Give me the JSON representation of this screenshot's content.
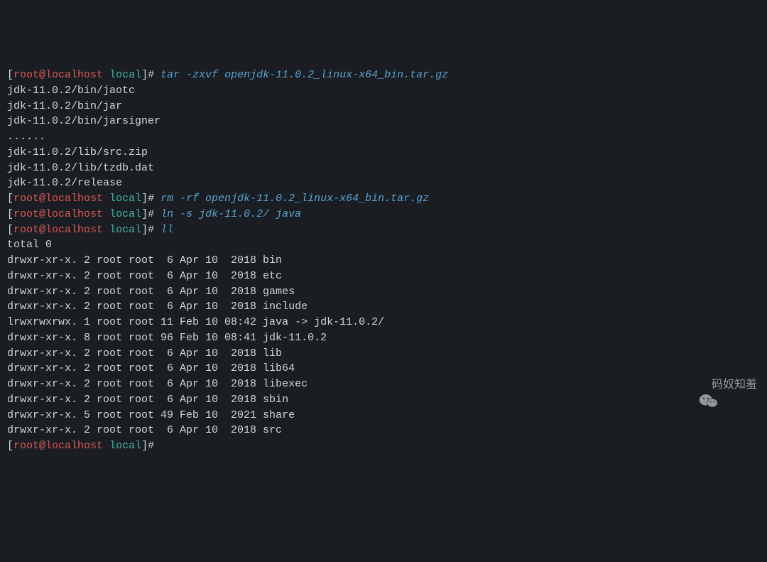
{
  "prompt": {
    "user_host": "root@localhost",
    "cwd": "local",
    "symbol": "#"
  },
  "lines": [
    {
      "t": "prompt",
      "cmd": "tar -zxvf openjdk-11.0.2_linux-x64_bin.tar.gz"
    },
    {
      "t": "out",
      "text": "jdk-11.0.2/bin/jaotc"
    },
    {
      "t": "out",
      "text": "jdk-11.0.2/bin/jar"
    },
    {
      "t": "out",
      "text": "jdk-11.0.2/bin/jarsigner"
    },
    {
      "t": "out",
      "text": "......"
    },
    {
      "t": "out",
      "text": "jdk-11.0.2/lib/src.zip"
    },
    {
      "t": "out",
      "text": "jdk-11.0.2/lib/tzdb.dat"
    },
    {
      "t": "out",
      "text": "jdk-11.0.2/release"
    },
    {
      "t": "prompt",
      "cmd": "rm -rf openjdk-11.0.2_linux-x64_bin.tar.gz"
    },
    {
      "t": "prompt",
      "cmd": "ln -s jdk-11.0.2/ java"
    },
    {
      "t": "prompt",
      "cmd": "ll"
    },
    {
      "t": "out",
      "text": "total 0"
    },
    {
      "t": "out",
      "text": "drwxr-xr-x. 2 root root  6 Apr 10  2018 bin"
    },
    {
      "t": "out",
      "text": "drwxr-xr-x. 2 root root  6 Apr 10  2018 etc"
    },
    {
      "t": "out",
      "text": "drwxr-xr-x. 2 root root  6 Apr 10  2018 games"
    },
    {
      "t": "out",
      "text": "drwxr-xr-x. 2 root root  6 Apr 10  2018 include"
    },
    {
      "t": "out",
      "text": "lrwxrwxrwx. 1 root root 11 Feb 10 08:42 java -> jdk-11.0.2/"
    },
    {
      "t": "out",
      "text": "drwxr-xr-x. 8 root root 96 Feb 10 08:41 jdk-11.0.2"
    },
    {
      "t": "out",
      "text": "drwxr-xr-x. 2 root root  6 Apr 10  2018 lib"
    },
    {
      "t": "out",
      "text": "drwxr-xr-x. 2 root root  6 Apr 10  2018 lib64"
    },
    {
      "t": "out",
      "text": "drwxr-xr-x. 2 root root  6 Apr 10  2018 libexec"
    },
    {
      "t": "out",
      "text": "drwxr-xr-x. 2 root root  6 Apr 10  2018 sbin"
    },
    {
      "t": "out",
      "text": "drwxr-xr-x. 5 root root 49 Feb 10  2021 share"
    },
    {
      "t": "out",
      "text": "drwxr-xr-x. 2 root root  6 Apr 10  2018 src"
    },
    {
      "t": "prompt",
      "cmd": ""
    }
  ],
  "watermark": {
    "text": "码奴知羞",
    "icon": "wechat-icon"
  }
}
